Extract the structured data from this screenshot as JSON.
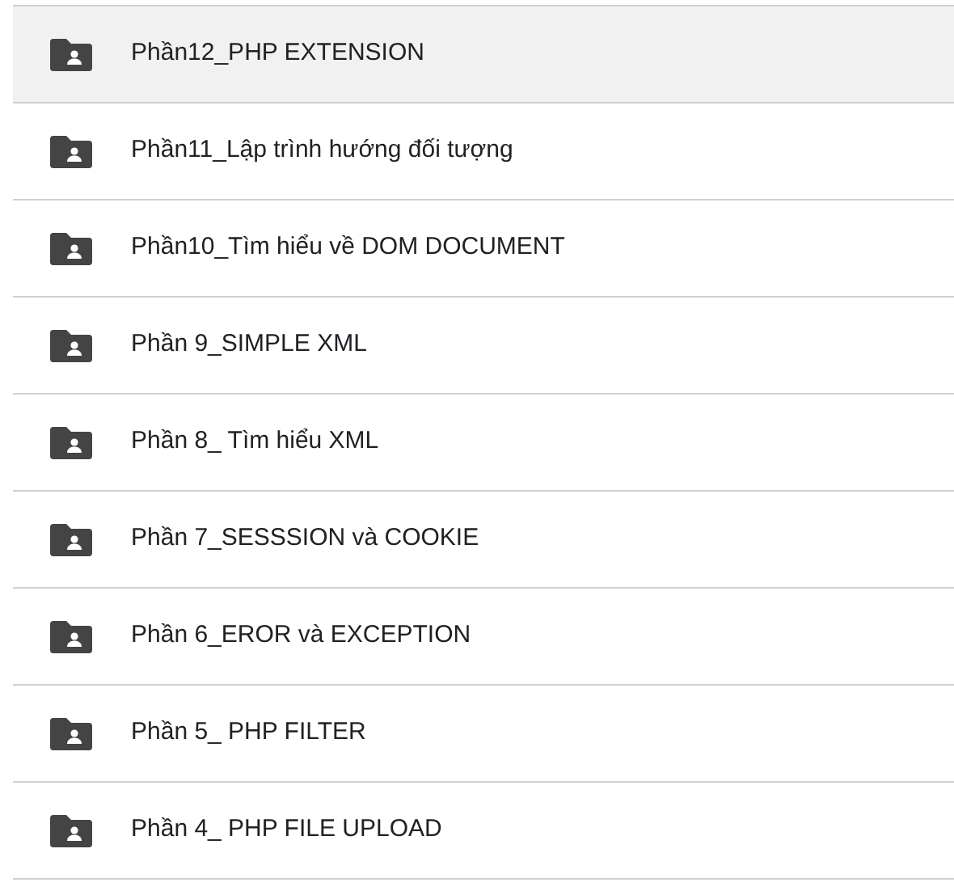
{
  "folders": [
    {
      "name": "Phần12_PHP EXTENSION",
      "selected": true
    },
    {
      "name": "Phần11_Lập trình hướng đối tượng",
      "selected": false
    },
    {
      "name": "Phần10_Tìm hiểu về DOM DOCUMENT",
      "selected": false
    },
    {
      "name": "Phần 9_SIMPLE XML",
      "selected": false
    },
    {
      "name": "Phần 8_ Tìm hiểu XML",
      "selected": false
    },
    {
      "name": "Phần 7_SESSSION và COOKIE",
      "selected": false
    },
    {
      "name": "Phần 6_EROR và EXCEPTION",
      "selected": false
    },
    {
      "name": "Phần 5_ PHP FILTER",
      "selected": false
    },
    {
      "name": "Phần 4_ PHP FILE UPLOAD",
      "selected": false
    }
  ]
}
